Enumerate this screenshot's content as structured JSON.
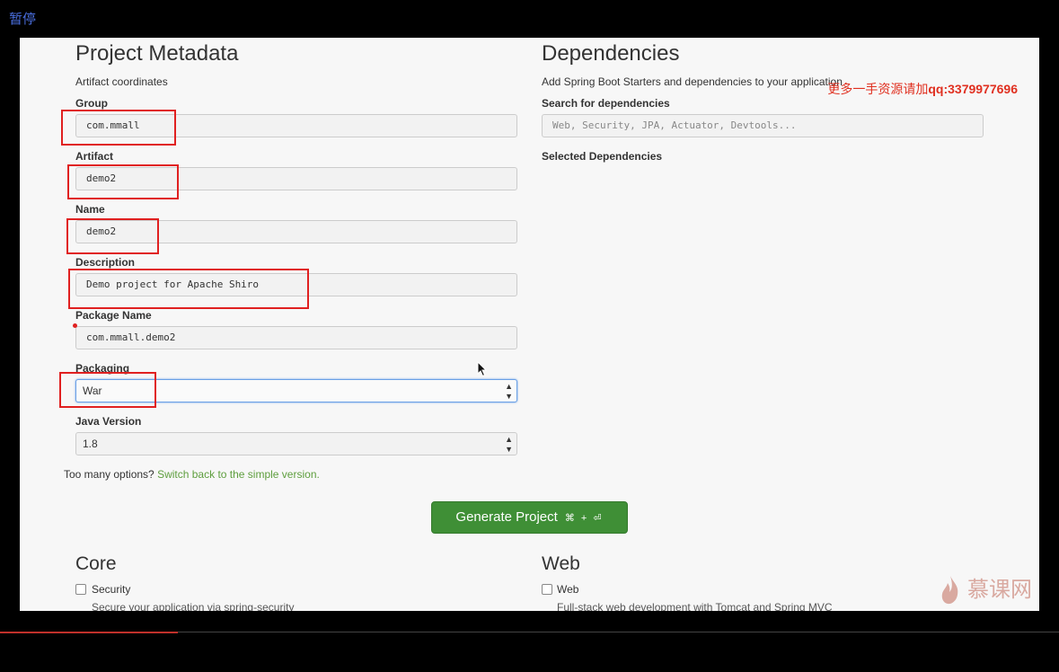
{
  "player": {
    "pause_label": "暂停",
    "progress_fraction": 0.168
  },
  "metadata": {
    "title": "Project Metadata",
    "subtitle": "Artifact coordinates",
    "fields": {
      "group": {
        "label": "Group",
        "value": "com.mmall"
      },
      "artifact": {
        "label": "Artifact",
        "value": "demo2"
      },
      "name": {
        "label": "Name",
        "value": "demo2"
      },
      "description": {
        "label": "Description",
        "value": "Demo project for Apache Shiro"
      },
      "package_name": {
        "label": "Package Name",
        "value": "com.mmall.demo2"
      },
      "packaging": {
        "label": "Packaging",
        "value": "War"
      },
      "java_version": {
        "label": "Java Version",
        "value": "1.8"
      }
    },
    "simple_prompt": "Too many options?",
    "simple_link": "Switch back to the simple version."
  },
  "dependencies": {
    "title": "Dependencies",
    "subtitle": "Add Spring Boot Starters and dependencies to your application",
    "search_label": "Search for dependencies",
    "search_placeholder": "Web, Security, JPA, Actuator, Devtools...",
    "selected_label": "Selected Dependencies"
  },
  "generate": {
    "label": "Generate Project",
    "shortcut": "⌘ + ⏎"
  },
  "sections": {
    "core": {
      "title": "Core",
      "item_label": "Security",
      "item_desc": "Secure your application via spring-security"
    },
    "web": {
      "title": "Web",
      "item_label": "Web",
      "item_desc": "Full-stack web development with Tomcat and Spring MVC"
    }
  },
  "overlay": {
    "watermark_cn": "更多一手资源请加",
    "watermark_qq": "qq:3379977696",
    "logo_text": "慕课网"
  },
  "colors": {
    "accent_green": "#3f8f36",
    "link_green": "#5e9e3e",
    "annotation_red": "#e02020"
  }
}
